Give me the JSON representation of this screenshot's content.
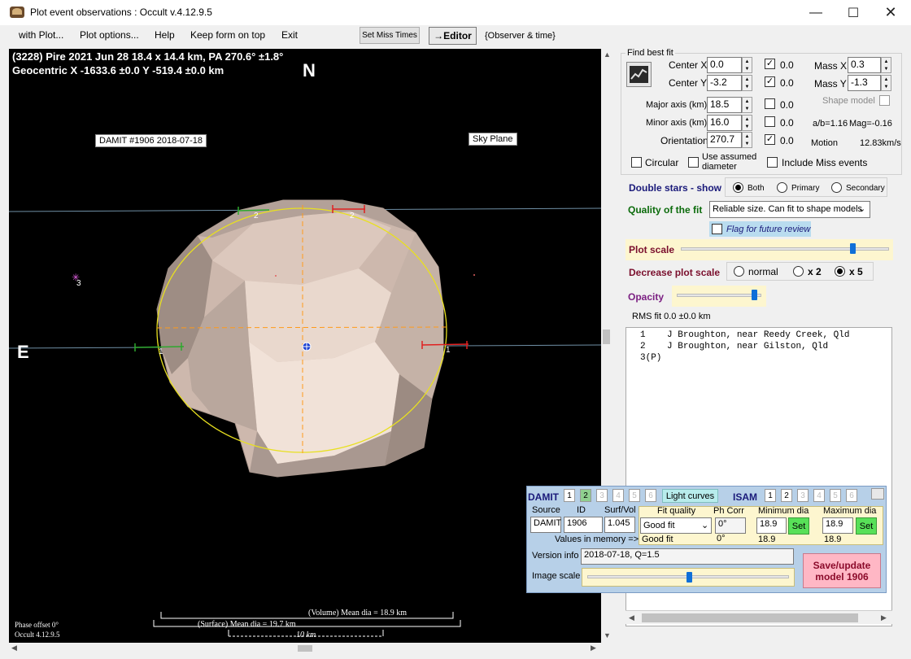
{
  "window": {
    "title": "Plot event observations : Occult v.4.12.9.5",
    "minimize": "—",
    "maximize": "☐",
    "close": "✕"
  },
  "menu": {
    "items": [
      "with Plot...",
      "Plot options...",
      "Help",
      "Keep form on top",
      "Exit"
    ],
    "set_miss_times": "Set Miss Times",
    "editor": "→Editor",
    "observer_time": "{Observer & time}"
  },
  "plot": {
    "header_line1": "(3228) Pire  2021 Jun 28   18.4 x 14.4 km, PA 270.6° ±1.8°",
    "header_line2": "Geocentric  X  -1633.6 ±0.0  Y  -519.4 ±0.0 km",
    "north": "N",
    "east": "E",
    "damit_label": "DAMIT #1906 2018-07-18",
    "sky_plane": "Sky Plane",
    "phase_offset": "Phase offset 0°",
    "occult_version": "Occult 4.12.9.5",
    "volume_mean_dia": "(Volume) Mean dia = 18.9 km",
    "surface_mean_dia": "(Surface) Mean dia = 19.7 km",
    "scale_bar": "10 km",
    "chord_labels": [
      "1",
      "1",
      "2",
      "2",
      "3"
    ]
  },
  "find_best_fit": {
    "group_title": "Find best fit",
    "center_x": {
      "label": "Center X",
      "value": "0.0",
      "check": "0.0",
      "checked": true
    },
    "center_y": {
      "label": "Center Y",
      "value": "-3.2",
      "check": "0.0",
      "checked": true
    },
    "mass_x": {
      "label": "Mass X",
      "value": "0.3"
    },
    "mass_y": {
      "label": "Mass Y",
      "value": "-1.3"
    },
    "major_axis": {
      "label": "Major axis (km)",
      "value": "18.5",
      "check": "0.0",
      "checked": false
    },
    "minor_axis": {
      "label": "Minor axis (km)",
      "value": "16.0",
      "check": "0.0",
      "checked": false
    },
    "orientation": {
      "label": "Orientation",
      "value": "270.7",
      "check": "0.0",
      "checked": true
    },
    "shape_model": "Shape model",
    "ab_ratio": "a/b=1.16",
    "mag": "Mag=-0.16",
    "motion_label": "Motion",
    "motion_value": "12.83km/s",
    "circular": "Circular",
    "use_assumed_diameter": "Use assumed diameter",
    "include_miss_events": "Include Miss events"
  },
  "double_stars": {
    "label": "Double stars - show",
    "options": [
      "Both",
      "Primary",
      "Secondary"
    ],
    "selected": "Both"
  },
  "quality": {
    "label": "Quality of the fit",
    "value": "Reliable size. Can fit to shape models",
    "flag": "Flag for future review"
  },
  "plot_scale": {
    "label": "Plot scale",
    "level": 0.83
  },
  "decrease_scale": {
    "label": "Decrease plot scale",
    "options": [
      "normal",
      "x 2",
      "x 5"
    ],
    "selected": "x 5"
  },
  "opacity": {
    "label": "Opacity",
    "level": 0.92
  },
  "rms_fit": "RMS fit 0.0 ±0.0 km",
  "observers": [
    {
      "n": "1",
      "name": "J Broughton, near Reedy Creek, Qld"
    },
    {
      "n": "2",
      "name": "J Broughton, near Gilston, Qld"
    },
    {
      "n": "3(P)",
      "name": ""
    }
  ],
  "damit_panel": {
    "damit": "DAMIT",
    "isam": "ISAM",
    "damit_nums": [
      "1",
      "2",
      "3",
      "4",
      "5",
      "6"
    ],
    "isam_nums": [
      "1",
      "2",
      "3",
      "4",
      "5",
      "6"
    ],
    "light_curves": "Light curves",
    "source_hdr": "Source",
    "id_hdr": "ID",
    "surfvol_hdr": "Surf/Vol",
    "source": "DAMIT",
    "id": "1906",
    "surfvol": "1.045",
    "fit_quality_hdr": "Fit quality",
    "ph_corr_hdr": "Ph Corr",
    "min_dia_hdr": "Minimum dia",
    "max_dia_hdr": "Maximum dia",
    "fit_quality": "Good fit",
    "ph_corr": "0°",
    "min_dia": "18.9",
    "max_dia": "18.9",
    "set": "Set",
    "values_in_memory": "Values in memory =>",
    "mem_fit_quality": "Good fit",
    "mem_ph_corr": "0°",
    "mem_min_dia": "18.9",
    "mem_max_dia": "18.9",
    "version_info_label": "Version info",
    "version_info": "2018-07-18, Q=1.5",
    "image_scale_label": "Image scale",
    "image_scale_level": 0.5,
    "save_update_line1": "Save/update",
    "save_update_line2": "model 1906"
  },
  "colors": {
    "title_blue": "#1a1a7a",
    "quality_green": "#0b6b0b",
    "scale_maroon": "#7a0f2d",
    "opacity_purple": "#7b1f82",
    "fit_ellipse": "#e8e020",
    "chord_orange": "#ff9a1a",
    "asteroid_fill": "#e2cfc4"
  }
}
